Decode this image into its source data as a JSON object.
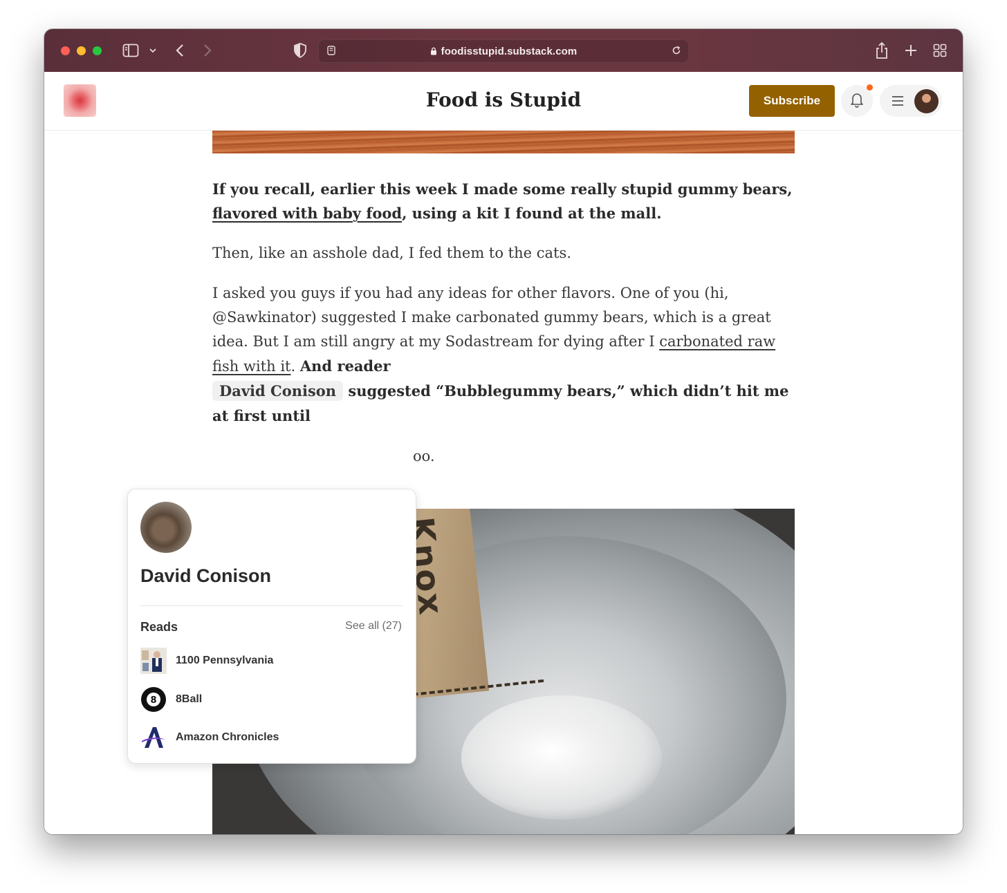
{
  "browser": {
    "url": "foodisstupid.substack.com"
  },
  "header": {
    "site_title": "Food is Stupid",
    "subscribe_label": "Subscribe",
    "colors": {
      "subscribe": "#946100",
      "notification_dot": "#ff6719"
    }
  },
  "article": {
    "p1_a": "If you recall, earlier this week I made some really stupid gummy bears, ",
    "p1_link": "flavored with baby food",
    "p1_b": ", using a kit I found at the mall.",
    "p2": "Then, like an asshole dad, I fed them to the cats.",
    "p3_a": "I asked you guys if you had any ideas for other flavors. One of you (hi, @Sawkinator) suggested I make carbonated gummy bears, which is a great idea. But I am still angry at my Sodastream for dying after I ",
    "p3_link": "carbonated raw fish with it",
    "p3_b": ". ",
    "p3_c": "And reader",
    "p3_mention": "David Conison",
    "p3_d": " suggested “Bubblegummy bears,” which didn’t hit me at first until",
    "p4_fragment": "oo."
  },
  "hover_card": {
    "name": "David Conison",
    "reads_label": "Reads",
    "see_all": "See all (27)",
    "reads": [
      {
        "name": "1100 Pennsylvania",
        "icon": "newsletter-thumbnail-icon"
      },
      {
        "name": "8Ball",
        "icon": "8ball-logo-icon"
      },
      {
        "name": "Amazon Chronicles",
        "icon": "amazon-chronicles-logo-icon"
      }
    ]
  },
  "photo": {
    "packet_text": "Knox"
  }
}
